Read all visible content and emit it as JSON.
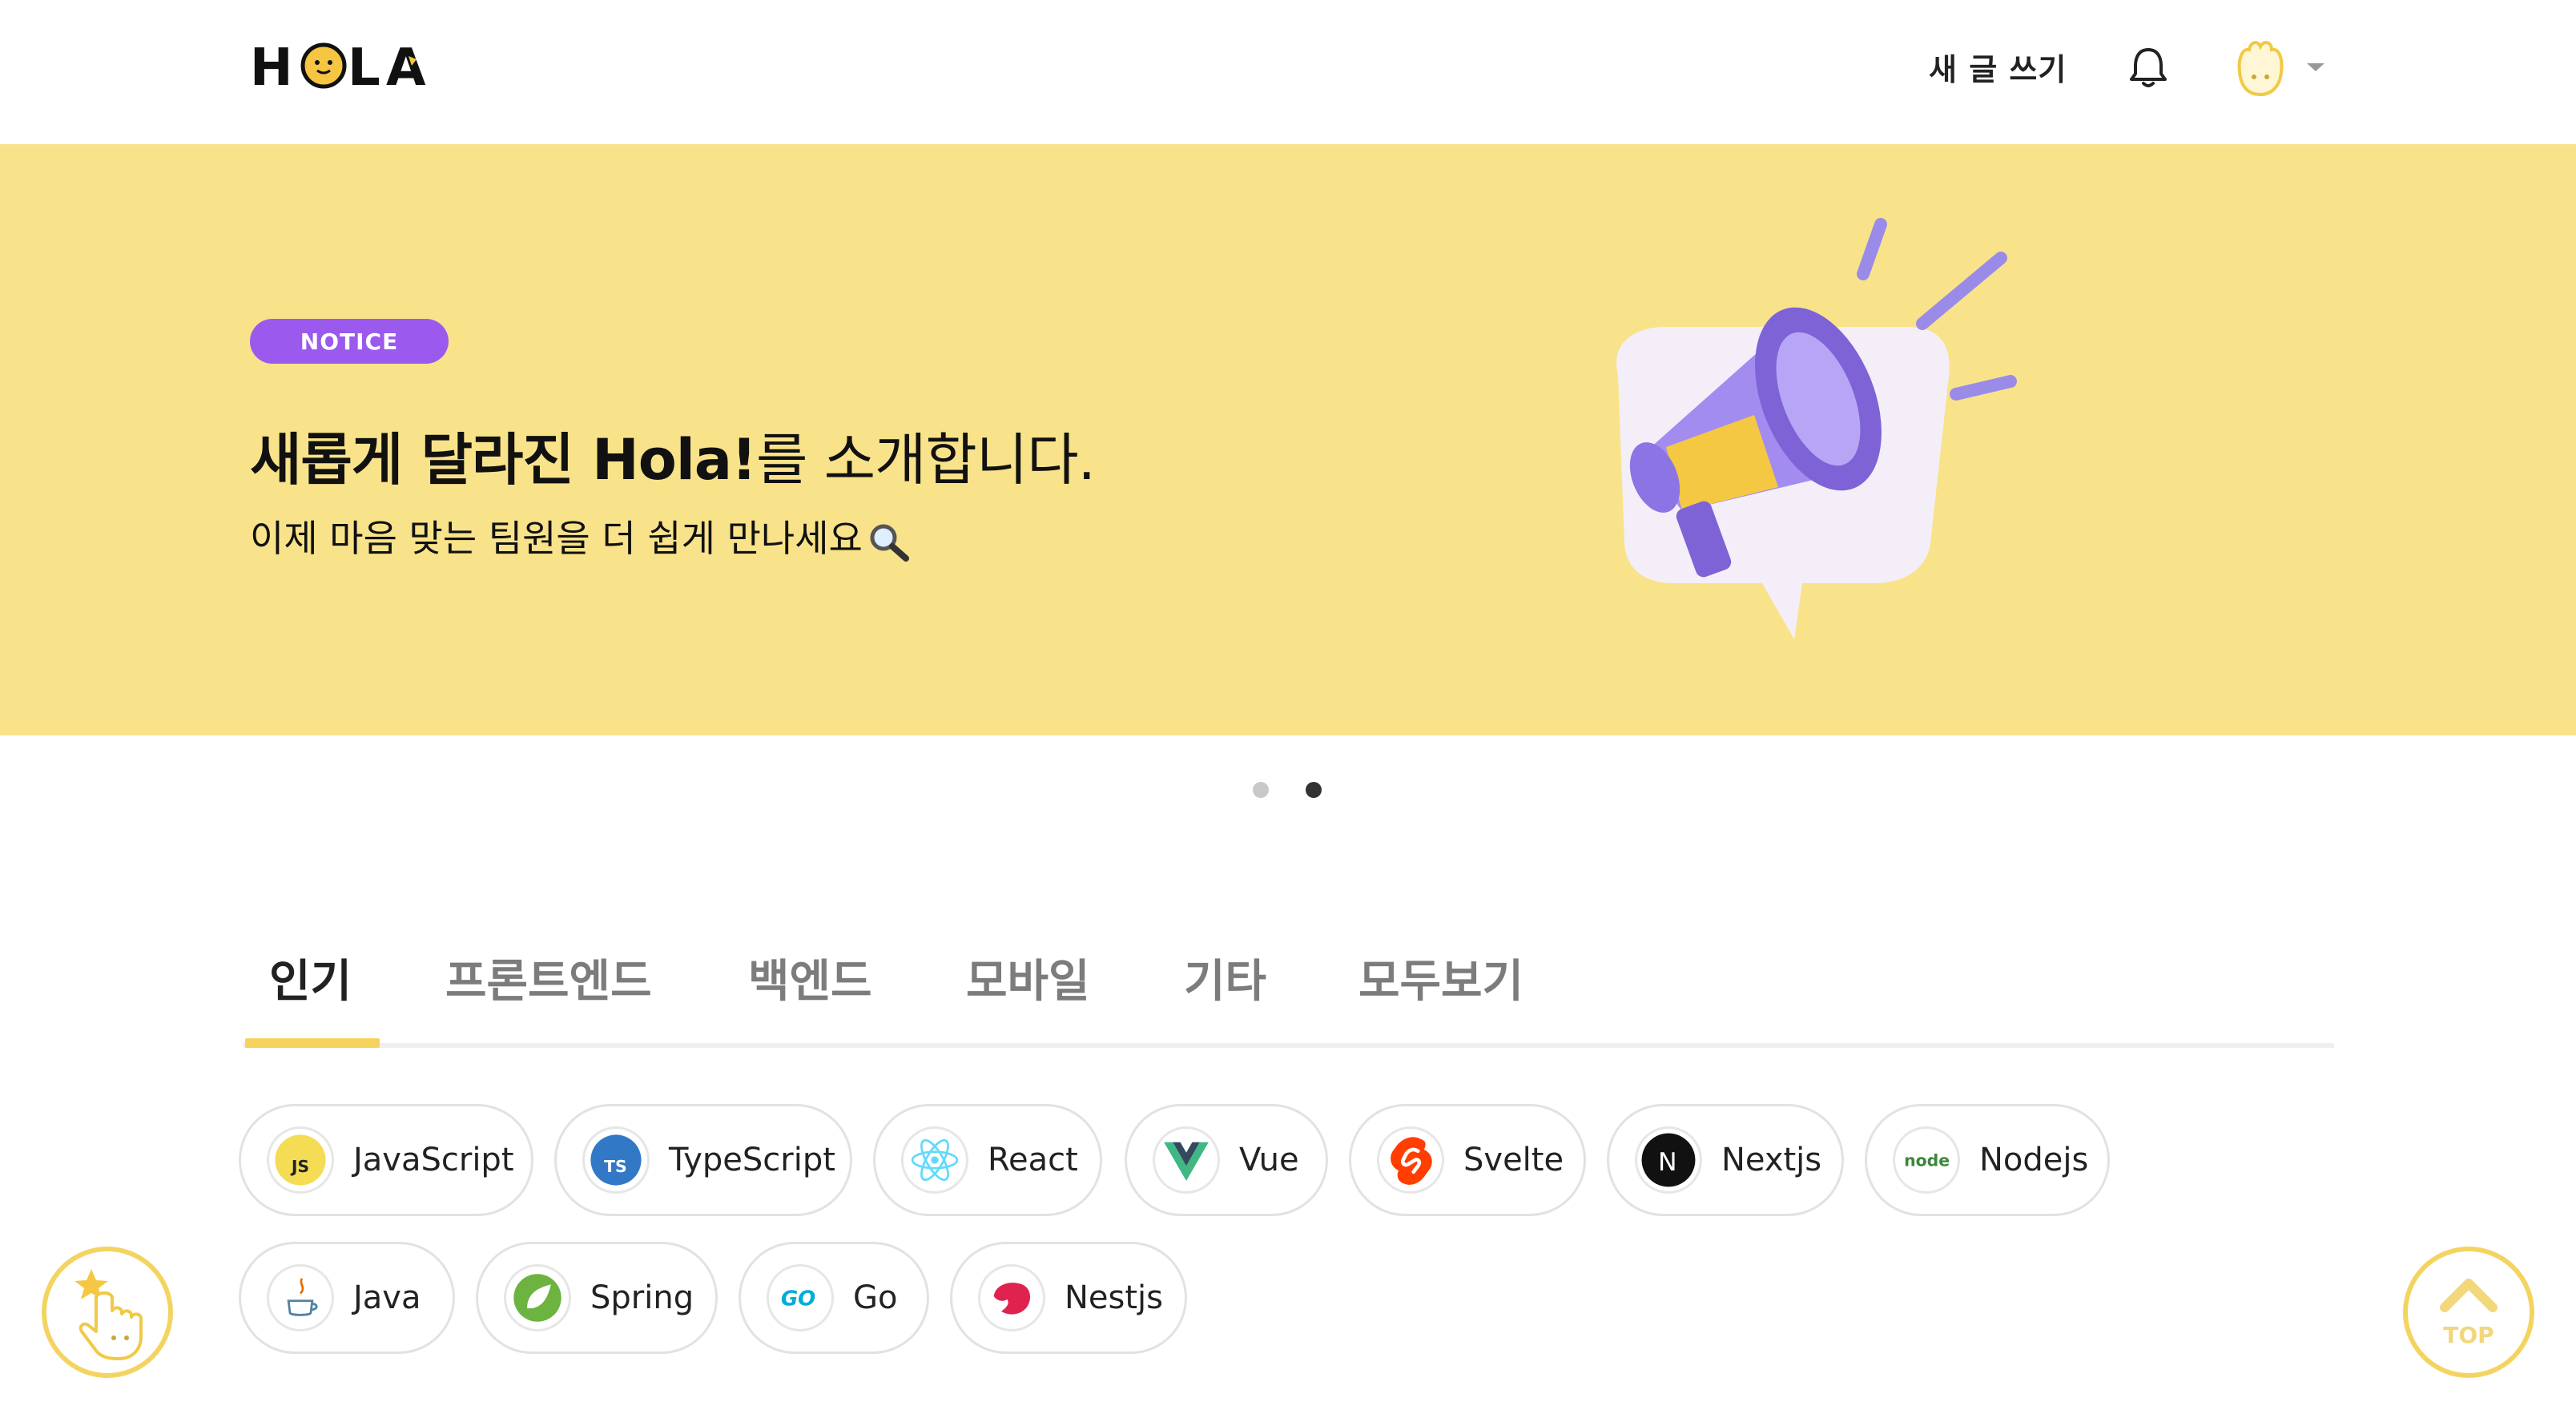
{
  "header": {
    "logo_text": "HOLA",
    "write_label": "새 글 쓰기",
    "notification_icon": "bell-icon",
    "avatar_icon": "avatar",
    "menu_icon": "caret-down-icon"
  },
  "banner": {
    "badge": "NOTICE",
    "title_bold": "새롭게 달라진 Hola!",
    "title_rest": "를 소개합니다.",
    "subtitle": "이제 마음 맞는 팀원을 더 쉽게 만나세요",
    "subtitle_icon": "magnifier-icon",
    "illustration": "megaphone-illustration",
    "background_color": "#f9e38a",
    "badge_color": "#9b59ee"
  },
  "carousel": {
    "slides": 2,
    "active_index": 2
  },
  "tabs": [
    {
      "label": "인기",
      "active": true
    },
    {
      "label": "프론트엔드",
      "active": false
    },
    {
      "label": "백엔드",
      "active": false
    },
    {
      "label": "모바일",
      "active": false
    },
    {
      "label": "기타",
      "active": false
    },
    {
      "label": "모두보기",
      "active": false
    }
  ],
  "tech_stacks": [
    {
      "label": "JavaScript",
      "icon": "javascript-icon"
    },
    {
      "label": "TypeScript",
      "icon": "typescript-icon"
    },
    {
      "label": "React",
      "icon": "react-icon"
    },
    {
      "label": "Vue",
      "icon": "vue-icon"
    },
    {
      "label": "Svelte",
      "icon": "svelte-icon"
    },
    {
      "label": "Nextjs",
      "icon": "nextjs-icon"
    },
    {
      "label": "Nodejs",
      "icon": "nodejs-icon"
    },
    {
      "label": "Java",
      "icon": "java-icon"
    },
    {
      "label": "Spring",
      "icon": "spring-icon"
    },
    {
      "label": "Go",
      "icon": "go-icon"
    },
    {
      "label": "Nestjs",
      "icon": "nestjs-icon"
    }
  ],
  "floating": {
    "left_icon": "pointing-hand-star-icon",
    "top_label": "TOP"
  },
  "colors": {
    "accent_yellow": "#f6d35c",
    "tab_active": "#222222",
    "tab_inactive": "#7c7c7c"
  }
}
